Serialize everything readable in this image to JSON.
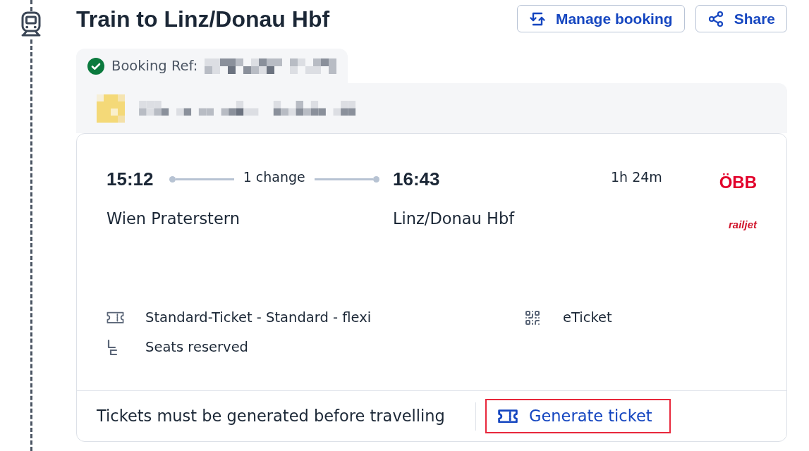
{
  "trip": {
    "title": "Train to Linz/Donau Hbf"
  },
  "actions": [
    {
      "kind": "manage",
      "label": "Manage booking"
    },
    {
      "kind": "share",
      "label": "Share"
    }
  ],
  "booking": {
    "ref_label": "Booking Ref:"
  },
  "journey": {
    "departure": {
      "time": "15:12",
      "station": "Wien Praterstern"
    },
    "changes": "1 change",
    "arrival": {
      "time": "16:43",
      "station": "Linz/Donau Hbf"
    },
    "duration": "1h 24m",
    "operator": "ÖBB",
    "service": "railjet"
  },
  "features": [
    {
      "kind": "ticket",
      "label": "Standard-Ticket - Standard - flexi"
    },
    {
      "kind": "qr",
      "label": "eTicket"
    },
    {
      "kind": "seat",
      "label": "Seats reserved"
    }
  ],
  "footer": {
    "notice": "Tickets must be generated before travelling",
    "action": {
      "label": "Generate ticket",
      "highlighted": true
    }
  }
}
